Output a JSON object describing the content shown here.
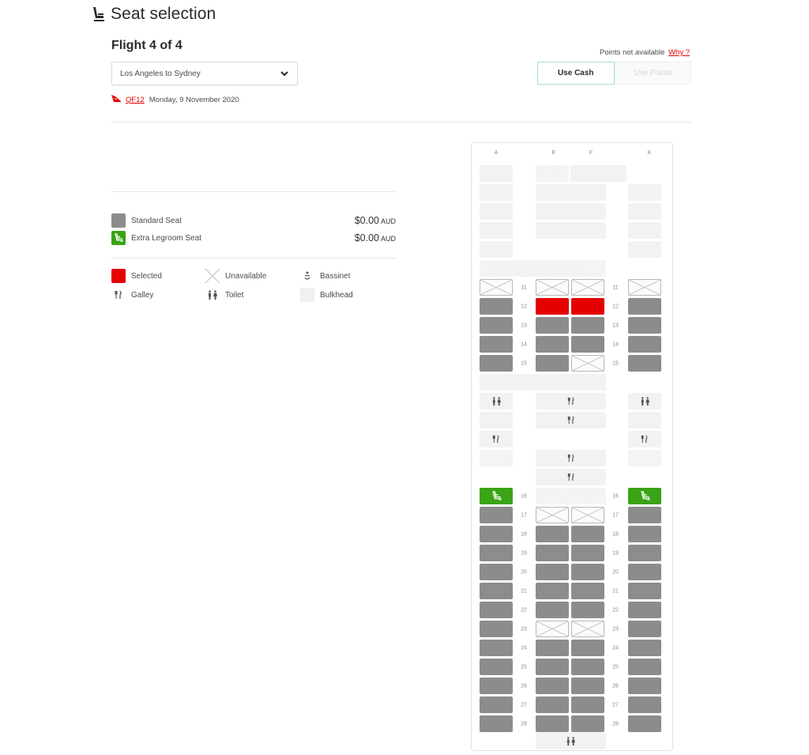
{
  "header": {
    "title": "Seat selection",
    "icon": "seat-icon"
  },
  "flight": {
    "title": "Flight 4 of 4",
    "route_selected": "Los Angeles to Sydney",
    "flight_number": "QF12",
    "date": "Monday, 9 November 2020",
    "airline_icon": "kangaroo-tail-icon"
  },
  "payment": {
    "points_note": "Points not available",
    "why_link": "Why ?",
    "options": [
      {
        "label": "Use Cash",
        "state": "active"
      },
      {
        "label": "Use Points",
        "state": "disabled"
      }
    ]
  },
  "pricing": [
    {
      "label": "Standard Seat",
      "price": "$0.00",
      "currency": "AUD",
      "color": "#8c8c8c"
    },
    {
      "label": "Extra Legroom Seat",
      "price": "$0.00",
      "currency": "AUD",
      "color": "#3aa316"
    }
  ],
  "legend": [
    {
      "label": "Selected",
      "icon": "selected-swatch"
    },
    {
      "label": "Unavailable",
      "icon": "cross-icon"
    },
    {
      "label": "Bassinet",
      "icon": "bassinet-icon"
    },
    {
      "label": "Galley",
      "icon": "galley-icon"
    },
    {
      "label": "Toilet",
      "icon": "toilet-icon"
    },
    {
      "label": "Bulkhead",
      "icon": "bulkhead-swatch"
    }
  ],
  "colors": {
    "accent_red": "#e40000",
    "standard_seat": "#8c8c8c",
    "legroom_seat": "#3aa316",
    "facility": "#f2f2f2",
    "cash_border": "#a9dcd8"
  },
  "seatmap": {
    "columns": [
      "A",
      "E",
      "F",
      "K"
    ],
    "rows": [
      {
        "row": "11",
        "A": "unavailable",
        "E": "unavailable",
        "F": "unavailable",
        "K": "unavailable"
      },
      {
        "row": "12",
        "A": "standard",
        "E": "selected",
        "F": "selected",
        "K": "standard"
      },
      {
        "row": "13",
        "A": "standard",
        "E": "standard",
        "F": "standard",
        "K": "standard"
      },
      {
        "row": "14",
        "A": "standard",
        "E": "standard",
        "F": "standard",
        "K": "standard"
      },
      {
        "row": "15",
        "A": "standard",
        "E": "standard",
        "F": "unavailable",
        "K": "standard"
      },
      {
        "row": "16",
        "A": "legroom",
        "E": "bulkhead",
        "F": "bulkhead",
        "K": "legroom"
      },
      {
        "row": "17",
        "A": "standard",
        "E": "unavailable",
        "F": "unavailable",
        "K": "standard"
      },
      {
        "row": "18",
        "A": "standard",
        "E": "standard",
        "F": "standard",
        "K": "standard"
      },
      {
        "row": "19",
        "A": "standard",
        "E": "standard",
        "F": "standard",
        "K": "standard"
      },
      {
        "row": "20",
        "A": "standard",
        "E": "standard",
        "F": "standard",
        "K": "standard"
      },
      {
        "row": "21",
        "A": "standard",
        "E": "standard",
        "F": "standard",
        "K": "standard"
      },
      {
        "row": "22",
        "A": "standard",
        "E": "standard",
        "F": "standard",
        "K": "standard"
      },
      {
        "row": "23",
        "A": "standard",
        "E": "unavailable",
        "F": "unavailable",
        "K": "standard"
      },
      {
        "row": "24",
        "A": "standard",
        "E": "standard",
        "F": "standard",
        "K": "standard"
      },
      {
        "row": "25",
        "A": "standard",
        "E": "standard",
        "F": "standard",
        "K": "standard"
      },
      {
        "row": "26",
        "A": "standard",
        "E": "standard",
        "F": "standard",
        "K": "standard"
      },
      {
        "row": "27",
        "A": "standard",
        "E": "standard",
        "F": "standard",
        "K": "standard"
      },
      {
        "row": "28",
        "A": "standard",
        "E": "standard",
        "F": "standard",
        "K": "standard"
      }
    ]
  }
}
